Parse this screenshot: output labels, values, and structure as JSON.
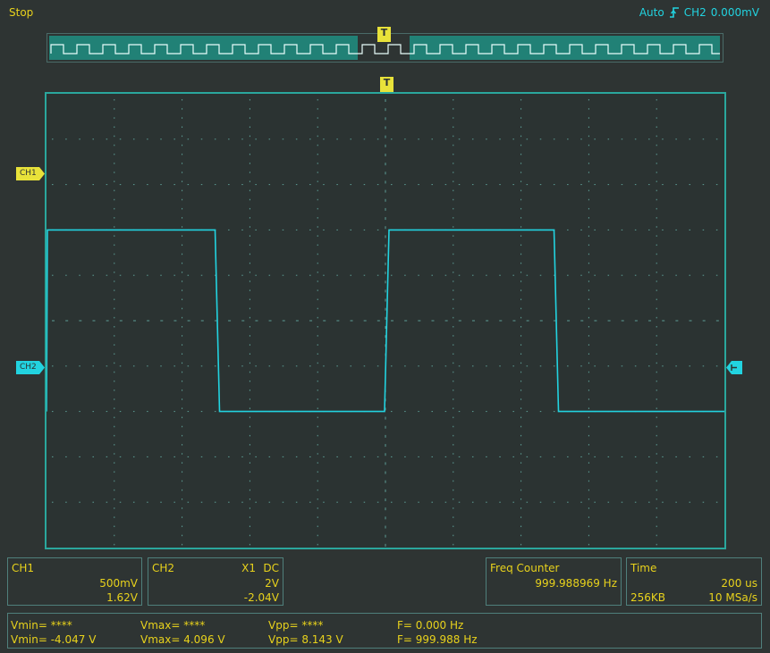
{
  "status": {
    "run_state": "Stop",
    "trigger_mode": "Auto",
    "trigger_source": "CH2",
    "trigger_level": "0.000mV",
    "trigger_edge_icon": "rising-edge-icon"
  },
  "markers": {
    "trigger": "T",
    "ch1": "CH1",
    "ch2": "CH2"
  },
  "colors": {
    "background": "#2e3433",
    "accent_yellow": "#e8d21c",
    "ch2_cyan": "#22d3e0",
    "grid_border": "#2aa79d"
  },
  "waveform": {
    "channel": "CH2",
    "shape": "square",
    "high_div": 2.0,
    "low_div": -2.0,
    "period_div": 5.0,
    "rise_at_div": [
      0.0,
      5.0
    ],
    "fall_at_div": [
      2.5,
      7.5
    ]
  },
  "panels": {
    "ch1": {
      "title": "CH1",
      "scale": "500mV",
      "offset": "1.62V"
    },
    "ch2": {
      "title": "CH2",
      "probe": "X1",
      "coupling": "DC",
      "scale": "2V",
      "offset": "-2.04V"
    },
    "freq": {
      "title": "Freq Counter",
      "value": "999.988969 Hz"
    },
    "time": {
      "title": "Time",
      "timebase": "200 us",
      "memory": "256KB",
      "sample_rate": "10 MSa/s"
    }
  },
  "measurements": {
    "ch1": {
      "vmin": "Vmin= ****",
      "vmax": "Vmax= ****",
      "vpp": "Vpp= ****",
      "freq": "F= 0.000 Hz"
    },
    "ch2": {
      "vmin": "Vmin= -4.047 V",
      "vmax": "Vmax= 4.096 V",
      "vpp": "Vpp= 8.143 V",
      "freq": "F= 999.988 Hz"
    }
  }
}
